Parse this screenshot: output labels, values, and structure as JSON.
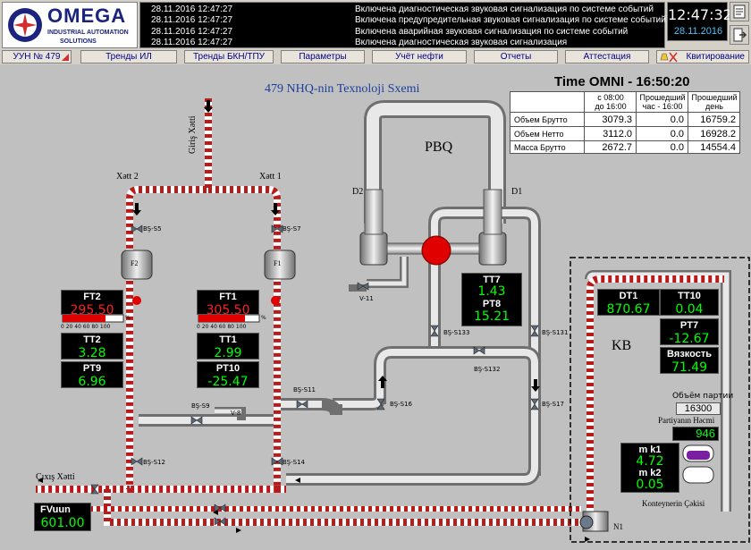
{
  "logo": {
    "brand": "OMEGA",
    "sub1": "INDUSTRIAL AUTOMATION",
    "sub2": "SOLUTIONS"
  },
  "events": [
    {
      "time": "28.11.2016 12:47:27",
      "msg": "Включена диагностическая звуковая сигнализация по системе событий"
    },
    {
      "time": "28.11.2016 12:47:27",
      "msg": "Включена предупредительная звуковая сигнализация по системе событий"
    },
    {
      "time": "28.11.2016 12:47:27",
      "msg": "Включена аварийная звуковая сигнализация по системе событий"
    },
    {
      "time": "28.11.2016 12:47:27",
      "msg": "Включена диагностическая звуковая сигнализация"
    }
  ],
  "clock": {
    "time": "12:47:32",
    "date": "28.11.2016"
  },
  "nav": {
    "unit": "УУН № 479",
    "trend_il": "Тренды ИЛ",
    "trend_bkn": "Тренды БКН/ТПУ",
    "params": "Параметры",
    "oil": "Учёт нефти",
    "reports": "Отчеты",
    "attest": "Аттестация",
    "ack": "Квитирование"
  },
  "scheme": {
    "title": "479 NHQ-nin Texnoloji Sxemi",
    "omni": "Time OMNI - 16:50:20",
    "pbq": "PBQ",
    "kb": "KB",
    "giris": "Giriş Xətti",
    "cixis": "Çıxış Xətti",
    "xett2": "Xətt 2",
    "xett1": "Xətt 1",
    "d1": "D1",
    "d2": "D2",
    "f1": "F1",
    "f2": "F2",
    "konteyner": "Konteynerin Çəkisi",
    "partiya_label": "Объём партии",
    "partiya_val": "16300",
    "partiyanin": "Partiyanın Həcmi",
    "partiyanin_val": "946",
    "n1": "N1"
  },
  "summary": {
    "headers": [
      "с 08:00\nдо 16:00",
      "Прошедший\nчас - 16:00",
      "Прошедший\nдень"
    ],
    "rows": [
      {
        "name": "Объем Брутто",
        "a": "3079.3",
        "b": "0.0",
        "c": "16759.2"
      },
      {
        "name": "Объем Нетто",
        "a": "3112.0",
        "b": "0.0",
        "c": "16928.2"
      },
      {
        "name": "Масса Брутто",
        "a": "2672.7",
        "b": "0.0",
        "c": "14554.4"
      }
    ]
  },
  "sensors": {
    "ft2": {
      "label": "FT2",
      "value": "295.50"
    },
    "ft1": {
      "label": "FT1",
      "value": "305.50"
    },
    "tt2": {
      "label": "TT2",
      "value": "3.28"
    },
    "tt1": {
      "label": "TT1",
      "value": "2.99"
    },
    "pt9": {
      "label": "PT9",
      "value": "6.96"
    },
    "pt10": {
      "label": "PT10",
      "value": "-25.47"
    },
    "tt7": {
      "label": "TT7",
      "value": "1.43"
    },
    "pt8": {
      "label": "PT8",
      "value": "15.21"
    },
    "dt1": {
      "label": "DT1",
      "value": "870.67"
    },
    "tt10": {
      "label": "TT10",
      "value": "0.04"
    },
    "pt7": {
      "label": "PT7",
      "value": "-12.67"
    },
    "visc": {
      "label": "Вязкость",
      "value": "71.49"
    },
    "mk1": {
      "label": "m k1",
      "value": "4.72"
    },
    "mk2": {
      "label": "m k2",
      "value": "0.05"
    },
    "fvuun": {
      "label": "FVuun",
      "value": "601.00"
    }
  },
  "bar_scale": "0 20 40 60 80 100",
  "bar_unit": "%",
  "valves": [
    "BŞ-S5",
    "BŞ-S7",
    "BŞ-S12",
    "BŞ-S14",
    "BŞ-S9",
    "V-8",
    "BŞ-S11",
    "BŞ-S16",
    "BŞ-S17",
    "BŞ-S133",
    "BŞ-S132",
    "BŞ-S131",
    "V-11"
  ]
}
